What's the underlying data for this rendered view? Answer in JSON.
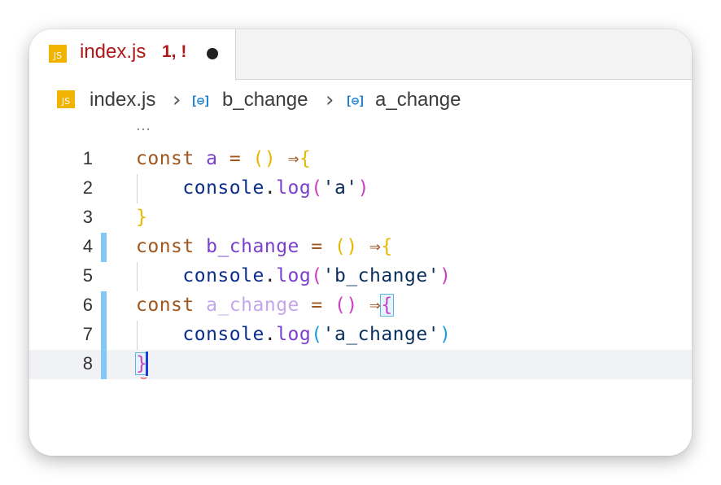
{
  "tab": {
    "icon": "js-file-icon",
    "icon_text": "JS",
    "filename": "index.js",
    "problems_badge": "1, !",
    "unsaved_indicator": "dot"
  },
  "breadcrumb": {
    "file_icon_text": "JS",
    "file": "index.js",
    "items": [
      {
        "icon": "variable-icon",
        "icon_text": "[⊖]",
        "label": "b_change"
      },
      {
        "icon": "variable-icon",
        "icon_text": "[⊖]",
        "label": "a_change"
      }
    ],
    "separator": "›"
  },
  "editor": {
    "folded_marker": "…",
    "current_line": 8,
    "modified_lines": [
      4,
      6,
      7,
      8
    ],
    "lines": [
      {
        "n": "1",
        "code": "const a = () ⇒{"
      },
      {
        "n": "2",
        "code": "    console.log('a')"
      },
      {
        "n": "3",
        "code": "}"
      },
      {
        "n": "4",
        "code": "const b_change = () ⇒{"
      },
      {
        "n": "5",
        "code": "    console.log('b_change')"
      },
      {
        "n": "6",
        "code": "const a_change = () ⇒{"
      },
      {
        "n": "7",
        "code": "    console.log('a_change')"
      },
      {
        "n": "8",
        "code": "}"
      }
    ]
  },
  "colors": {
    "keyword": "#a0561c",
    "variable": "#7b3fcf",
    "bracket_level1": "#e6b800",
    "bracket_level2": "#cc3fc2",
    "bracket_level3": "#1f9ee0",
    "tab_error_text": "#b01818",
    "gutter_modified": "#82c8f4"
  }
}
